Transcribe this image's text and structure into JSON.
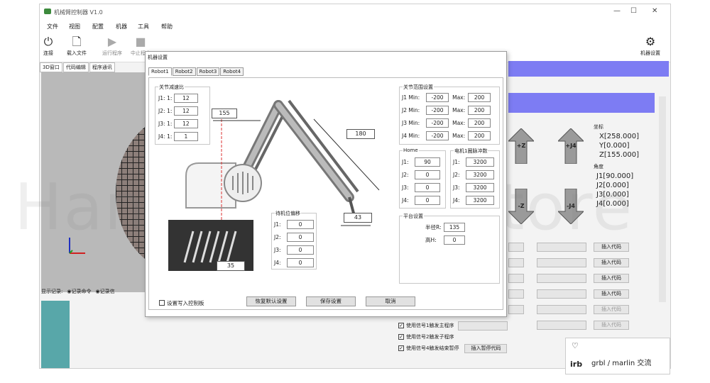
{
  "window": {
    "title": "机械臂控制器 V1.0",
    "min": "—",
    "max": "☐",
    "close": "✕"
  },
  "menu": [
    "文件",
    "视图",
    "配置",
    "机器",
    "工具",
    "帮助"
  ],
  "toolbar": [
    {
      "icon": "power-icon",
      "label": "连接"
    },
    {
      "icon": "file-icon",
      "label": "载入文件"
    },
    {
      "icon": "play-icon",
      "label": "运行程序"
    },
    {
      "icon": "stop-icon",
      "label": "中止程序"
    }
  ],
  "machine_settings_label": "机器设置",
  "left_tabs": [
    "3D窗口",
    "代码编辑",
    "程序通讯"
  ],
  "log_bar": [
    "显示记录:",
    "◉记录命令",
    "◉记录信"
  ],
  "coords": {
    "pos_label": "坐标",
    "x": "X[258.000]",
    "y": "Y[0.000]",
    "z": "Z[155.000]",
    "angle_label": "角度",
    "j1": "J1[90.000]",
    "j2": "J2[0.000]",
    "j3": "J3[0.000]",
    "j4": "J4[0.000]"
  },
  "jog": {
    "zplus": "+Z",
    "j4plus": "+J4",
    "zminus": "-Z",
    "j4minus": "-J4"
  },
  "insert_code": "插入代码",
  "pause_code": "插入暂停代码",
  "checks": [
    {
      "label": "使用信号1触发主程序",
      "checked": true
    },
    {
      "label": "使用信号2触发子程序",
      "checked": true
    },
    {
      "label": "使用信号4触发结束暂停",
      "checked": true
    }
  ],
  "popup": {
    "logo": "irb",
    "text": "grbl / marlin 交流"
  },
  "dialog": {
    "title": "机器设置",
    "tabs": [
      "Robot1",
      "Robot2",
      "Robot3",
      "Robot4"
    ],
    "ratio_group": {
      "caption": "关节减速比",
      "rows": [
        {
          "label": "J1:",
          "sep": "1:",
          "value": "12"
        },
        {
          "label": "J2:",
          "sep": "1:",
          "value": "12"
        },
        {
          "label": "J3:",
          "sep": "1:",
          "value": "12"
        },
        {
          "label": "J4:",
          "sep": "1:",
          "value": "1"
        }
      ]
    },
    "range_group": {
      "caption": "关节范围设置",
      "rows": [
        {
          "min_label": "J1 Min:",
          "min": "-200",
          "max_label": "Max:",
          "max": "200"
        },
        {
          "min_label": "J2 Min:",
          "min": "-200",
          "max_label": "Max:",
          "max": "200"
        },
        {
          "min_label": "J3 Min:",
          "min": "-200",
          "max_label": "Max:",
          "max": "200"
        },
        {
          "min_label": "J4 Min:",
          "min": "-200",
          "max_label": "Max:",
          "max": "200"
        }
      ]
    },
    "home_group": {
      "caption": "Home",
      "rows": [
        {
          "label": "J1:",
          "value": "90"
        },
        {
          "label": "J2:",
          "value": "0"
        },
        {
          "label": "J3:",
          "value": "0"
        },
        {
          "label": "J4:",
          "value": "0"
        }
      ]
    },
    "pulse_group": {
      "caption": "电机1圈脉冲数",
      "rows": [
        {
          "label": "J1:",
          "value": "3200"
        },
        {
          "label": "J2:",
          "value": "3200"
        },
        {
          "label": "J3:",
          "value": "3200"
        },
        {
          "label": "J4:",
          "value": "3200"
        }
      ]
    },
    "slot_group": {
      "caption": "待机位偏移",
      "rows": [
        {
          "label": "J1:",
          "value": "0"
        },
        {
          "label": "J2:",
          "value": "0"
        },
        {
          "label": "J3:",
          "value": "0"
        },
        {
          "label": "J4:",
          "value": "0"
        }
      ]
    },
    "platform_group": {
      "caption": "平台设置",
      "radius_label": "半径R:",
      "radius": "135",
      "height_label": "高H:",
      "height": "0"
    },
    "dims": {
      "d155": "155",
      "d180": "180",
      "d43": "43",
      "d35": "35"
    },
    "write_label": "设置写入控制板",
    "restore": "恢复默认设置",
    "save": "保存设置",
    "cancel": "取消"
  },
  "watermark": "Hansa Robot Store"
}
